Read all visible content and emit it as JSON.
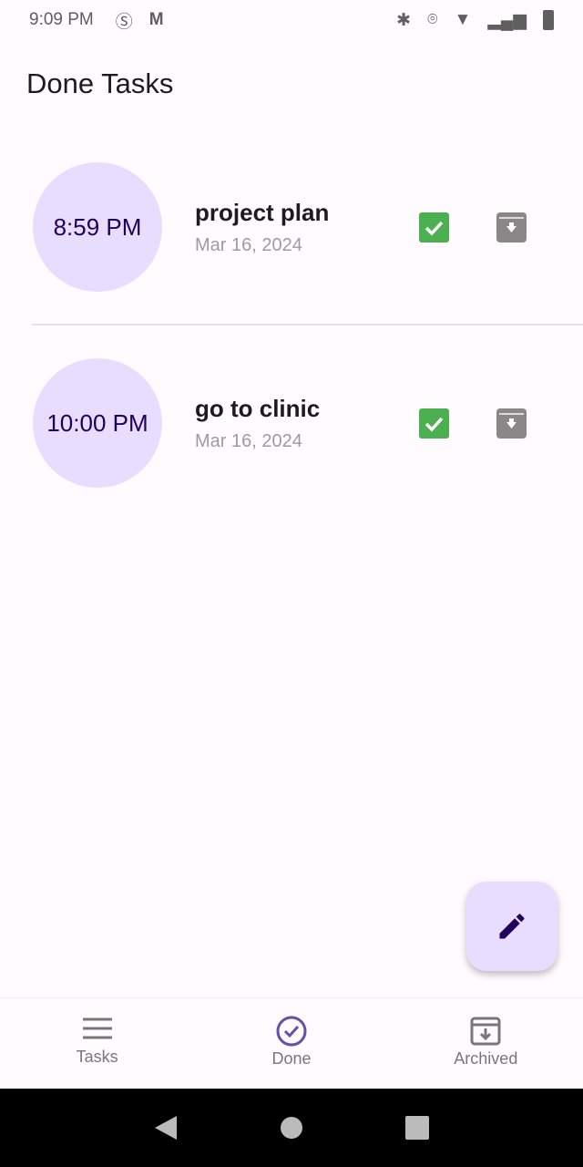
{
  "status": {
    "time": "9:09 PM"
  },
  "header": {
    "title": "Done Tasks"
  },
  "tasks": [
    {
      "time": "8:59 PM",
      "name": "project plan",
      "date": "Mar 16, 2024",
      "done": true
    },
    {
      "time": "10:00 PM",
      "name": "go to clinic",
      "date": "Mar 16, 2024",
      "done": true
    }
  ],
  "nav": {
    "items": [
      {
        "label": "Tasks"
      },
      {
        "label": "Done"
      },
      {
        "label": "Archived"
      }
    ],
    "active": "Done"
  },
  "colors": {
    "accent": "#6750a4",
    "check": "#4caf50",
    "circle": "#e9ddff"
  }
}
